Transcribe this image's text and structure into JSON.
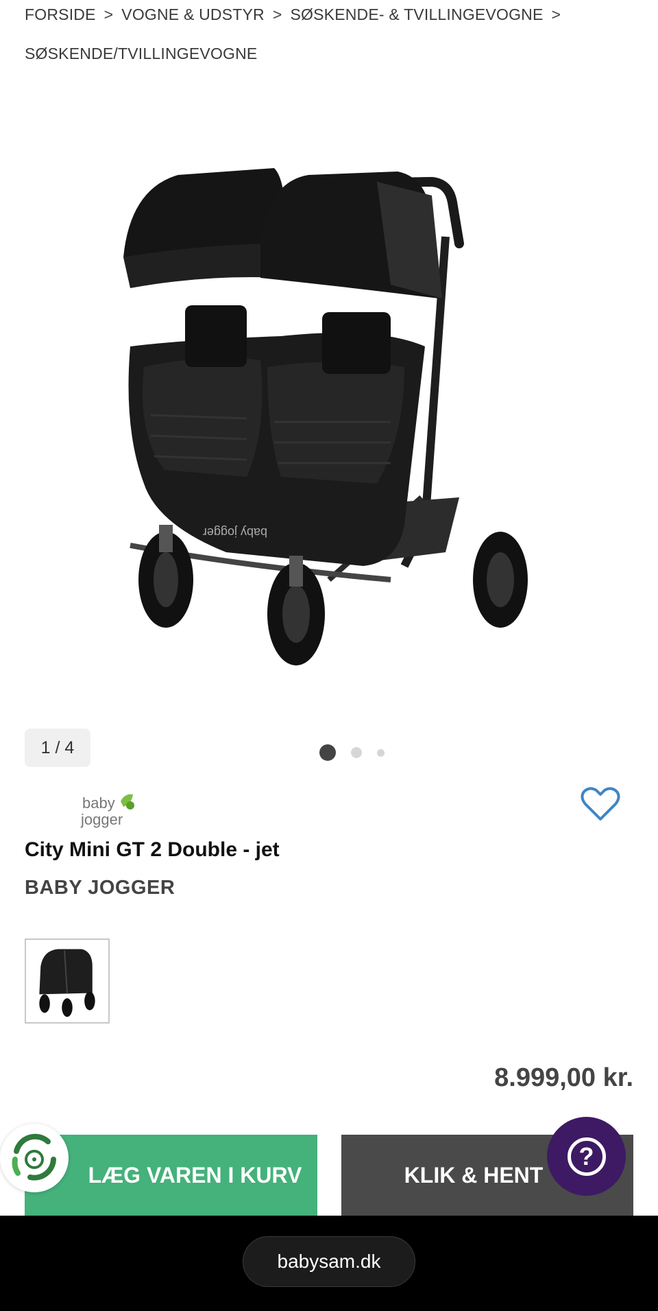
{
  "breadcrumb": {
    "items": [
      "FORSIDE",
      "VOGNE & UDSTYR",
      "SØSKENDE- & TVILLINGEVOGNE",
      "SØSKENDE/TVILLINGEVOGNE"
    ],
    "separator": ">"
  },
  "gallery": {
    "counter": "1 / 4",
    "image_alt": "City Mini GT 2 Double - jet"
  },
  "product": {
    "logo_text_1": "baby",
    "logo_text_2": "jogger",
    "title": "City Mini GT 2 Double - jet",
    "brand": "BABY JOGGER",
    "price": "8.999,00 kr."
  },
  "actions": {
    "add_to_cart": "LÆG VAREN I KURV",
    "click_collect": "KLIK & HENT",
    "help": "?"
  },
  "browser": {
    "url": "babysam.dk"
  },
  "colors": {
    "cart_button": "#45b17b",
    "click_collect_button": "#4a4a4a",
    "help_bubble": "#3d1a63",
    "favorite_icon": "#3d86c6"
  },
  "icons": [
    "heart-icon",
    "help-icon",
    "recycle-icon"
  ]
}
